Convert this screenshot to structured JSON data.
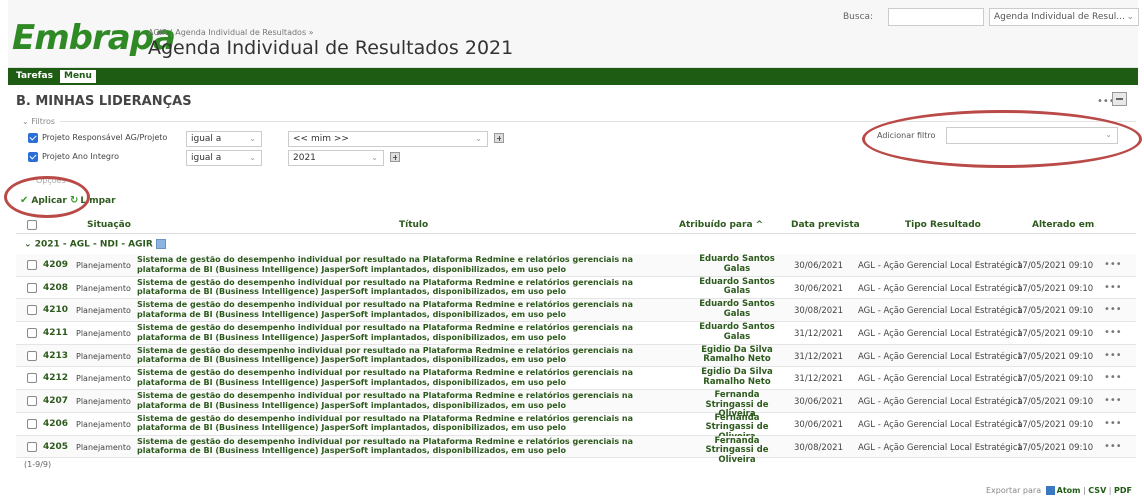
{
  "header": {
    "logo": "Embrapa",
    "breadcrumb": "AGIR | Agenda Individual de Resultados »",
    "title": "Agenda Individual de Resultados 2021",
    "search_label": "Busca:",
    "search_value": "",
    "project_select": "Agenda Individual de Resul..."
  },
  "menu": {
    "tabs": [
      "Tarefas",
      "Menu"
    ]
  },
  "section_title": "B. MINHAS LIDERANÇAS",
  "filters": {
    "label": "Filtros",
    "rows": [
      {
        "checked": true,
        "label": "Projeto Responsável AG/Projeto",
        "operator": "igual a",
        "value": "<< mim >>"
      },
      {
        "checked": true,
        "label": "Projeto Ano Integro",
        "operator": "igual a",
        "value": "2021"
      }
    ],
    "add_filter_label": "Adicionar filtro",
    "add_filter_value": ""
  },
  "options_label": "Opções",
  "actions": {
    "apply": "Aplicar",
    "clear": "Limpar"
  },
  "table": {
    "columns": [
      "Situação",
      "Título",
      "Atribuído para",
      "Data prevista",
      "Tipo Resultado",
      "Alterado em"
    ],
    "group": "2021 - AGL - NDI - AGIR",
    "rows": [
      {
        "id": "4209",
        "situacao": "Planejamento",
        "titulo": "Sistema de gestão do desempenho individual por resultado na Plataforma Redmine e relatórios gerenciais na plataforma de BI (Business Intelligence) JasperSoft implantados, disponibilizados, em uso pelo",
        "atribuido": "Eduardo Santos Galas",
        "data": "30/06/2021",
        "tipo": "AGL - Ação Gerencial Local Estratégica",
        "alterado": "17/05/2021 09:10"
      },
      {
        "id": "4208",
        "situacao": "Planejamento",
        "titulo": "Sistema de gestão do desempenho individual por resultado na Plataforma Redmine e relatórios gerenciais na plataforma de BI (Business Intelligence) JasperSoft implantados, disponibilizados, em uso pelo",
        "atribuido": "Eduardo Santos Galas",
        "data": "30/06/2021",
        "tipo": "AGL - Ação Gerencial Local Estratégica",
        "alterado": "17/05/2021 09:10"
      },
      {
        "id": "4210",
        "situacao": "Planejamento",
        "titulo": "Sistema de gestão do desempenho individual por resultado na Plataforma Redmine e relatórios gerenciais na plataforma de BI (Business Intelligence) JasperSoft implantados, disponibilizados, em uso pelo",
        "atribuido": "Eduardo Santos Galas",
        "data": "30/08/2021",
        "tipo": "AGL - Ação Gerencial Local Estratégica",
        "alterado": "17/05/2021 09:10"
      },
      {
        "id": "4211",
        "situacao": "Planejamento",
        "titulo": "Sistema de gestão do desempenho individual por resultado na Plataforma Redmine e relatórios gerenciais na plataforma de BI (Business Intelligence) JasperSoft implantados, disponibilizados, em uso pelo",
        "atribuido": "Eduardo Santos Galas",
        "data": "31/12/2021",
        "tipo": "AGL - Ação Gerencial Local Estratégica",
        "alterado": "17/05/2021 09:10"
      },
      {
        "id": "4213",
        "situacao": "Planejamento",
        "titulo": "Sistema de gestão do desempenho individual por resultado na Plataforma Redmine e relatórios gerenciais na plataforma de BI (Business Intelligence) JasperSoft implantados, disponibilizados, em uso pelo",
        "atribuido": "Egidio Da Silva Ramalho Neto",
        "data": "31/12/2021",
        "tipo": "AGL - Ação Gerencial Local Estratégica",
        "alterado": "17/05/2021 09:10"
      },
      {
        "id": "4212",
        "situacao": "Planejamento",
        "titulo": "Sistema de gestão do desempenho individual por resultado na Plataforma Redmine e relatórios gerenciais na plataforma de BI (Business Intelligence) JasperSoft implantados, disponibilizados, em uso pelo",
        "atribuido": "Egidio Da Silva Ramalho Neto",
        "data": "31/12/2021",
        "tipo": "AGL - Ação Gerencial Local Estratégica",
        "alterado": "17/05/2021 09:10"
      },
      {
        "id": "4207",
        "situacao": "Planejamento",
        "titulo": "Sistema de gestão do desempenho individual por resultado na Plataforma Redmine e relatórios gerenciais na plataforma de BI (Business Intelligence) JasperSoft implantados, disponibilizados, em uso pelo",
        "atribuido": "Fernanda Stringassi de Oliveira",
        "data": "30/06/2021",
        "tipo": "AGL - Ação Gerencial Local Estratégica",
        "alterado": "17/05/2021 09:10"
      },
      {
        "id": "4206",
        "situacao": "Planejamento",
        "titulo": "Sistema de gestão do desempenho individual por resultado na Plataforma Redmine e relatórios gerenciais na plataforma de BI (Business Intelligence) JasperSoft implantados, disponibilizados, em uso pelo",
        "atribuido": "Fernanda Stringassi de Oliveira",
        "data": "30/06/2021",
        "tipo": "AGL - Ação Gerencial Local Estratégica",
        "alterado": "17/05/2021 09:10"
      },
      {
        "id": "4205",
        "situacao": "Planejamento",
        "titulo": "Sistema de gestão do desempenho individual por resultado na Plataforma Redmine e relatórios gerenciais na plataforma de BI (Business Intelligence) JasperSoft implantados, disponibilizados, em uso pelo",
        "atribuido": "Fernanda Stringassi de Oliveira",
        "data": "30/08/2021",
        "tipo": "AGL - Ação Gerencial Local Estratégica",
        "alterado": "17/05/2021 09:10"
      }
    ]
  },
  "count": "(1-9/9)",
  "export": {
    "label": "Exportar para",
    "formats": [
      "Atom",
      "CSV",
      "PDF"
    ]
  },
  "colors": {
    "brand_green": "#2f8a25",
    "menubar": "#1e5c14",
    "link": "#2d5a1d",
    "annotation": "#b94a48"
  }
}
